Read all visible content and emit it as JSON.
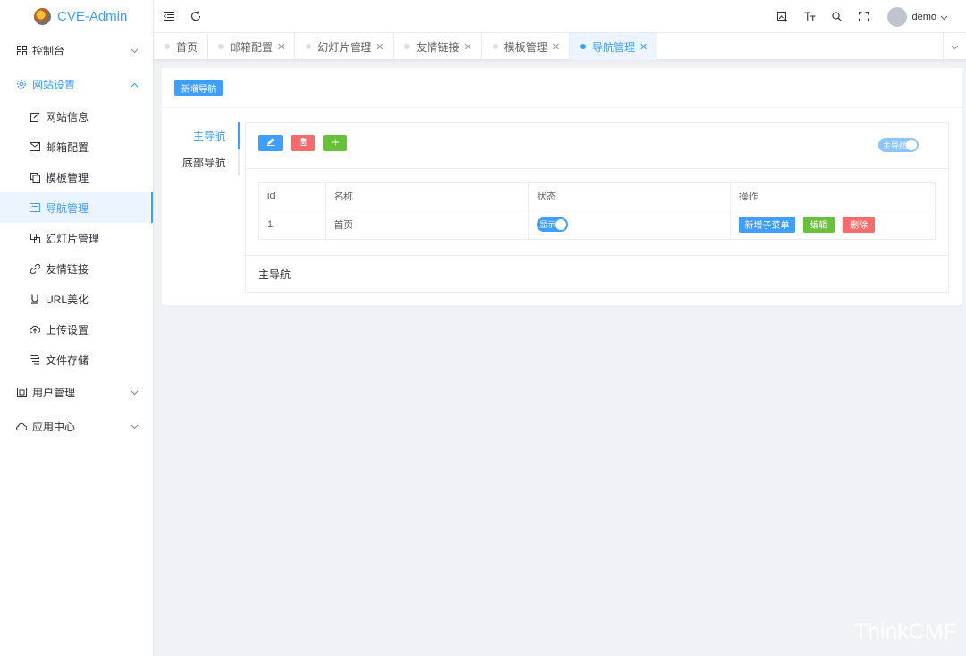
{
  "app": {
    "title": "CVE-Admin"
  },
  "sidebar": {
    "items": [
      {
        "label": "控制台",
        "icon": "grid-icon"
      },
      {
        "label": "网站设置",
        "icon": "gear-icon"
      }
    ],
    "submenu": [
      {
        "label": "网站信息",
        "icon": "edit-icon"
      },
      {
        "label": "邮箱配置",
        "icon": "mail-icon"
      },
      {
        "label": "模板管理",
        "icon": "copy-icon"
      },
      {
        "label": "导航管理",
        "icon": "nav-icon"
      },
      {
        "label": "幻灯片管理",
        "icon": "slides-icon"
      },
      {
        "label": "友情链接",
        "icon": "link-icon"
      },
      {
        "label": "URL美化",
        "icon": "underline-icon"
      },
      {
        "label": "上传设置",
        "icon": "upload-icon"
      },
      {
        "label": "文件存储",
        "icon": "storage-icon"
      }
    ],
    "bottom": [
      {
        "label": "用户管理",
        "icon": "user-box-icon"
      },
      {
        "label": "应用中心",
        "icon": "cloud-icon"
      }
    ]
  },
  "header": {
    "username": "demo"
  },
  "tabs": [
    "首页",
    "邮箱配置",
    "幻灯片管理",
    "友情链接",
    "模板管理",
    "导航管理"
  ],
  "main": {
    "add_button": "新增导航",
    "nav_tabs": [
      "主导航",
      "底部导航"
    ],
    "switch_label": "主导航",
    "table": {
      "columns": [
        "id",
        "名称",
        "状态",
        "操作"
      ],
      "rows": [
        {
          "id": "1",
          "name": "首页",
          "status": "显示",
          "actions": [
            "新增子菜单",
            "编辑",
            "删除"
          ]
        }
      ]
    },
    "footer_label": "主导航"
  },
  "watermark": "ThinkCMF",
  "colors": {
    "primary": "#409eff",
    "danger": "#f56c6c",
    "success": "#67c23a"
  }
}
